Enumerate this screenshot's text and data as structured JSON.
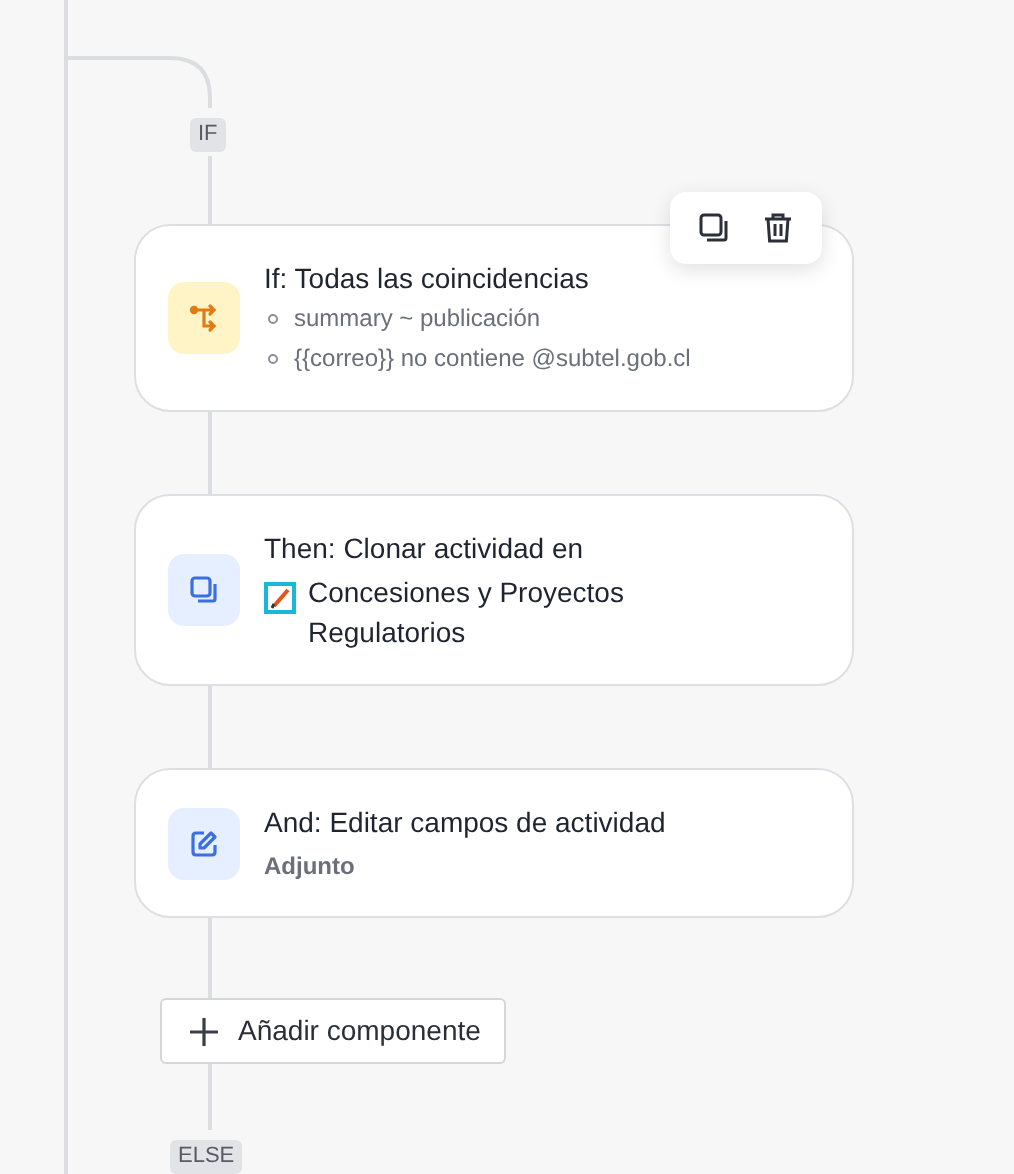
{
  "if_label": "IF",
  "steps": [
    {
      "kind": "condition",
      "title": "If: Todas las coincidencias",
      "conditions": [
        "summary ~ publicación",
        "{{correo}} no contiene @subtel.gob.cl"
      ],
      "show_toolbar": true
    },
    {
      "kind": "clone",
      "title": "Then: Clonar actividad en",
      "target": "Concesiones y Proyectos Regulatorios",
      "show_toolbar": false
    },
    {
      "kind": "edit",
      "title": "And: Editar campos de actividad",
      "detail": "Adjunto",
      "show_toolbar": false
    }
  ],
  "add_button": "Añadir componente",
  "else_label": "ELSE"
}
